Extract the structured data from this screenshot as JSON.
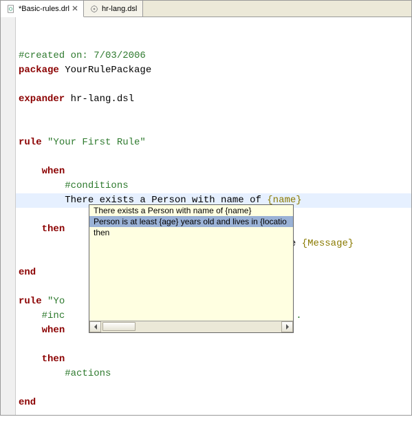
{
  "tabs": [
    {
      "label": "*Basic-rules.drl",
      "active": true,
      "closable": true
    },
    {
      "label": "hr-lang.dsl",
      "active": false,
      "closable": false
    }
  ],
  "code": {
    "l1_comment": "#created on: 7/03/2006",
    "l2_kw": "package",
    "l2_ident": " YourRulePackage",
    "l4_kw": "expander",
    "l4_ident": " hr-lang.dsl",
    "l7_kw": "rule",
    "l7_str": " \"Your First Rule\"",
    "l9_kw": "when",
    "l10_comment": "#conditions",
    "l11_text": "There exists a Person with name of ",
    "l11_tmpl": "{name}",
    "l13_kw": "then",
    "l14_text_tail": "essage ",
    "l14_tmpl": "{Message}",
    "l16_kw": "end",
    "l18_kw": "rule",
    "l18_str": " \"Yo",
    "l19_comment_a": "#inc",
    "l19_comment_b": "\" here...",
    "l20_kw": "when",
    "l22_kw": "then",
    "l23_comment": "#actions",
    "l25_kw": "end"
  },
  "autocomplete": {
    "items": [
      "There exists a Person with name of {name}",
      "Person is at least {age} years old and lives in {locatio",
      "then"
    ],
    "selected": 1
  }
}
